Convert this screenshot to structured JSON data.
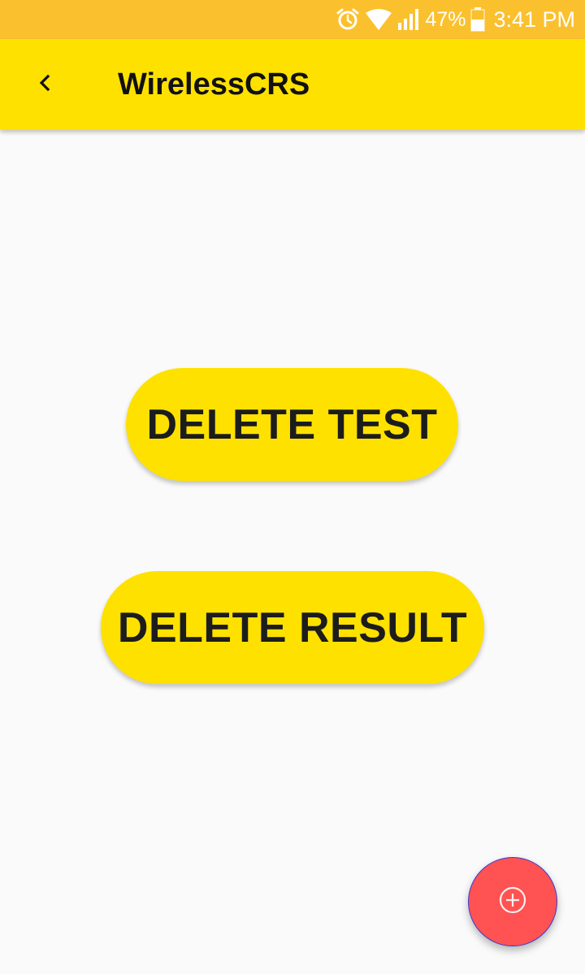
{
  "status_bar": {
    "battery": "47%",
    "time": "3:41 PM",
    "icons": [
      "alarm-icon",
      "wifi-icon",
      "signal-icon",
      "battery-icon"
    ],
    "background_color": "#fbc02d"
  },
  "app_bar": {
    "title": "WirelessCRS",
    "back_icon": "back-chevron-icon",
    "background_color": "#ffe100"
  },
  "main": {
    "buttons": [
      {
        "label": "DELETE TEST"
      },
      {
        "label": "DELETE RESULT"
      }
    ],
    "button_color": "#ffe100"
  },
  "fab": {
    "icon": "add-circle-icon",
    "color": "#ff5252"
  }
}
